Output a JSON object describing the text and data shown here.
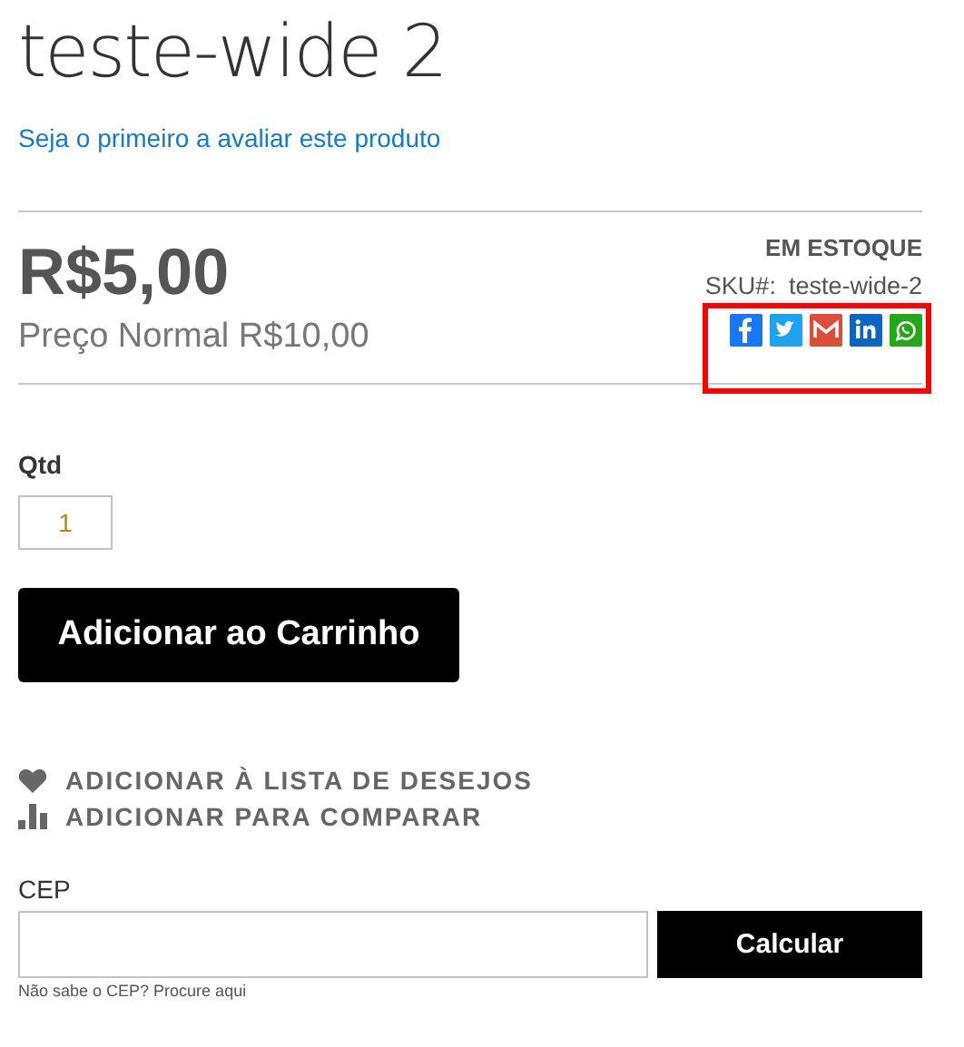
{
  "title": "teste-wide 2",
  "review_link": "Seja o primeiro a avaliar este produto",
  "price": "R$5,00",
  "regular_price": "Preço Normal R$10,00",
  "stock": "EM ESTOQUE",
  "sku_label": "SKU#:",
  "sku": "teste-wide-2",
  "share": [
    {
      "kind": "facebook",
      "color": "#1877f2"
    },
    {
      "kind": "twitter",
      "color": "#1da1f2"
    },
    {
      "kind": "gmail",
      "color": "#dd4b39"
    },
    {
      "kind": "linkedin",
      "color": "#0a66c2"
    },
    {
      "kind": "whatsapp",
      "color": "#25a71a"
    }
  ],
  "highlight": {
    "on": true
  },
  "qty_label": "Qtd",
  "qty": "1",
  "add_to_cart": "Adicionar ao Carrinho",
  "actions": [
    {
      "kind": "wishlist",
      "label": "ADICIONAR À LISTA DE DESEJOS"
    },
    {
      "kind": "compare",
      "label": "ADICIONAR PARA COMPARAR"
    }
  ],
  "cep_label": "CEP",
  "calc_button": "Calcular",
  "cep_hint": "Não sabe o CEP? Procure aqui"
}
